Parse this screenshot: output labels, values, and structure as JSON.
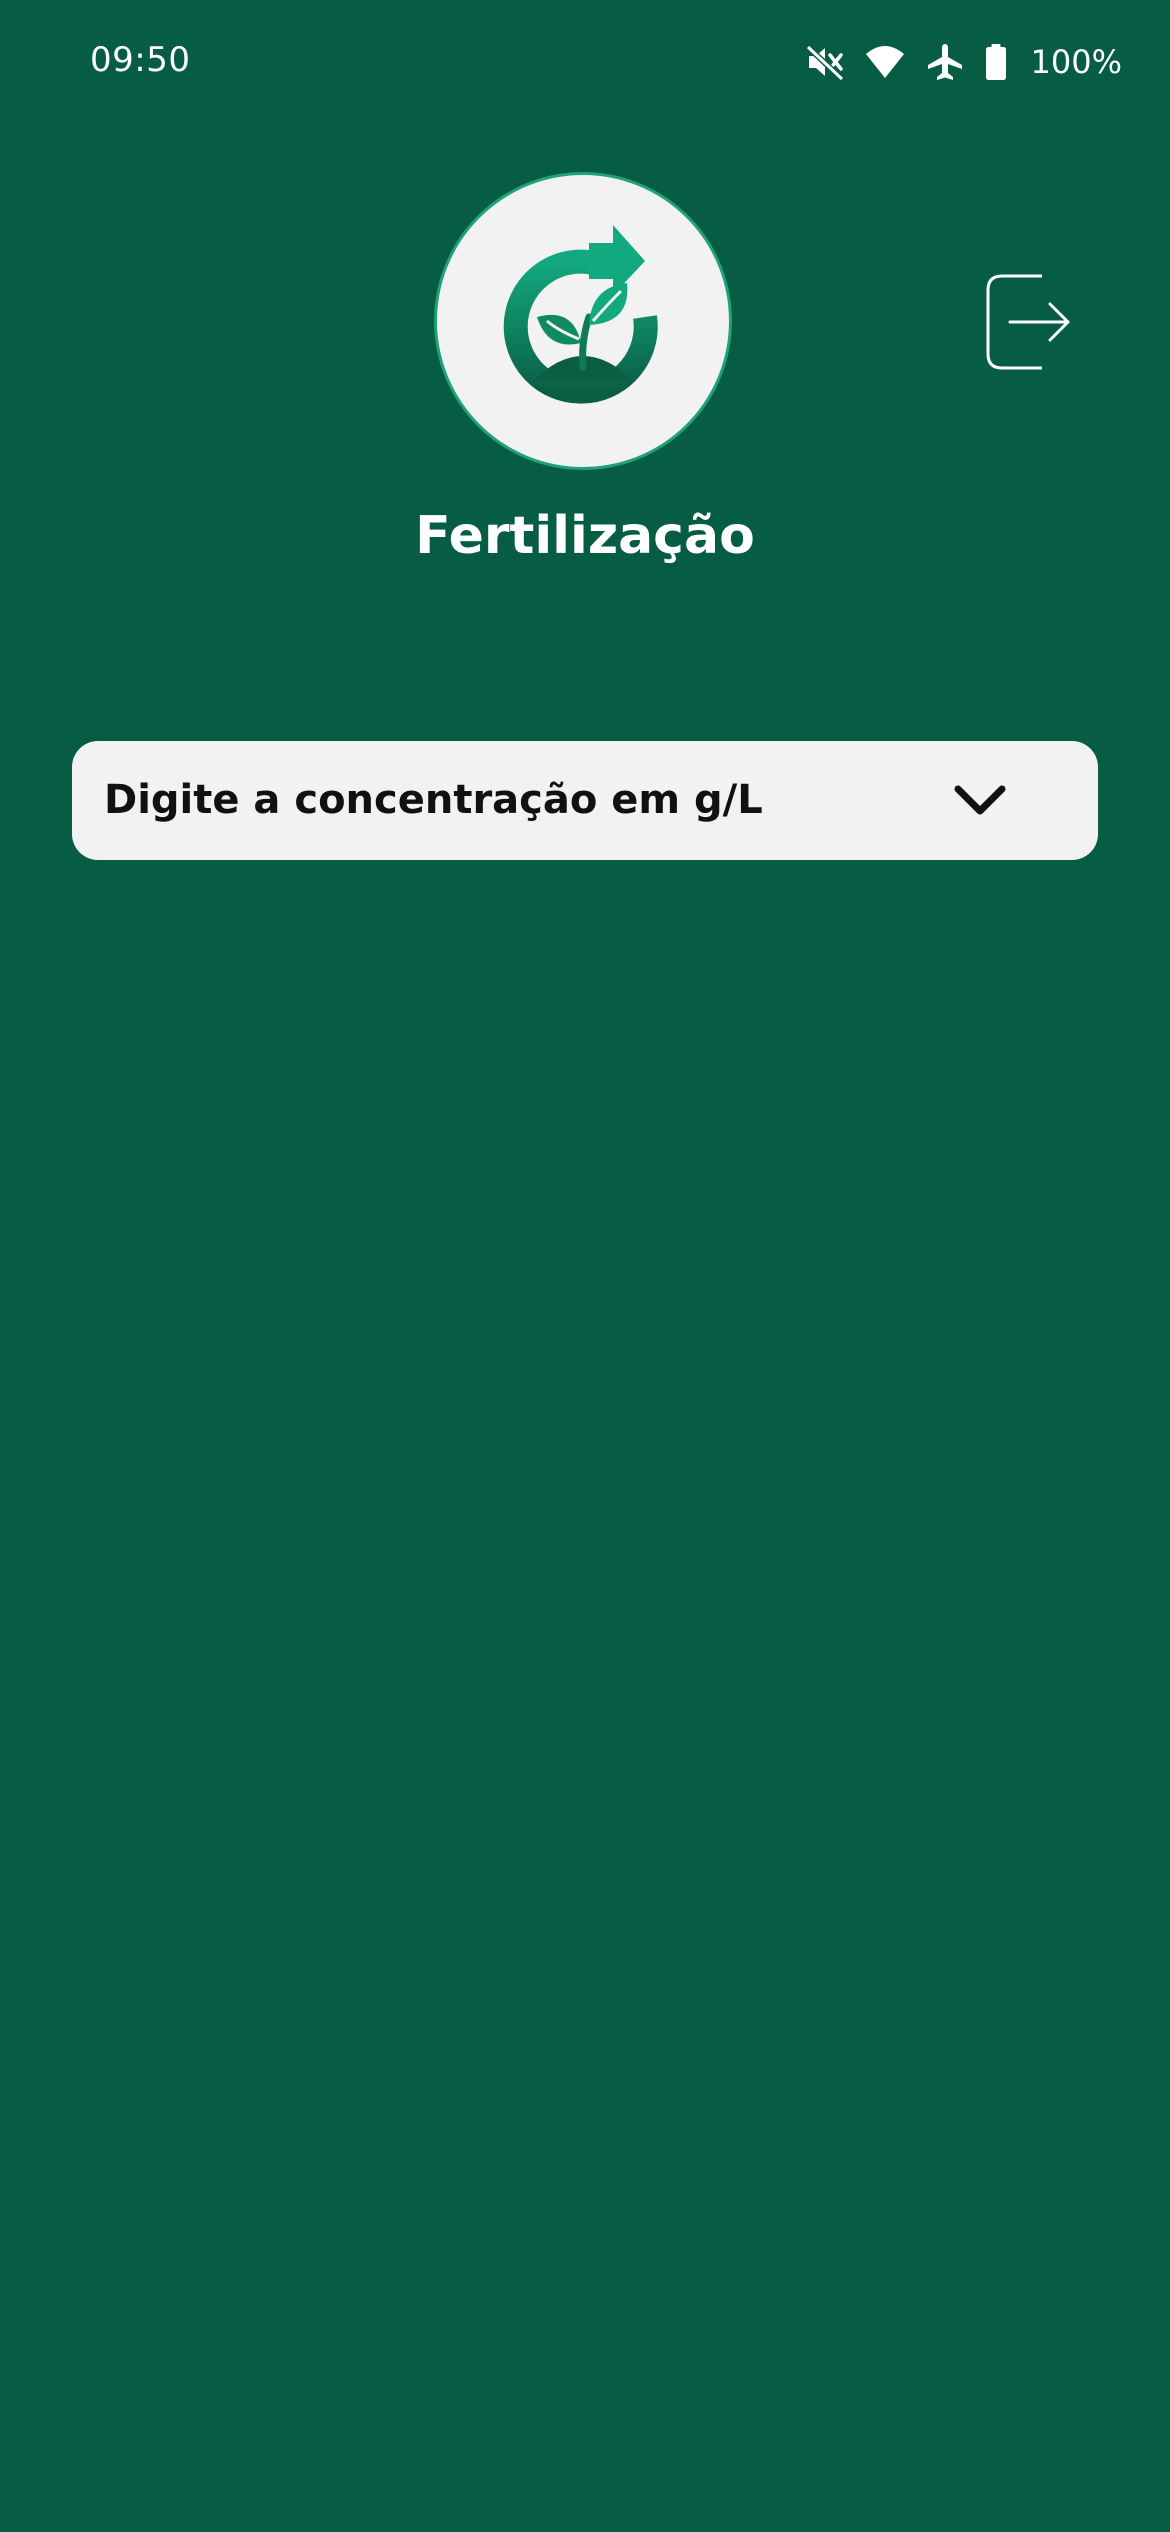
{
  "status_bar": {
    "time": "09:50",
    "battery_percent": "100%",
    "icons": [
      "mute-icon",
      "wifi-icon",
      "airplane-icon",
      "battery-icon"
    ]
  },
  "header": {
    "logo_icon": "plant-cycle-icon",
    "title": "Fertilização",
    "logout_icon": "logout-icon"
  },
  "form": {
    "concentration_dropdown": {
      "placeholder": "Digite a concentração em g/L",
      "icon": "chevron-down-icon"
    }
  },
  "colors": {
    "background": "#075c44",
    "card": "#f2f2f2",
    "accent": "#13a97e",
    "accent_dark": "#0a6a4c"
  }
}
